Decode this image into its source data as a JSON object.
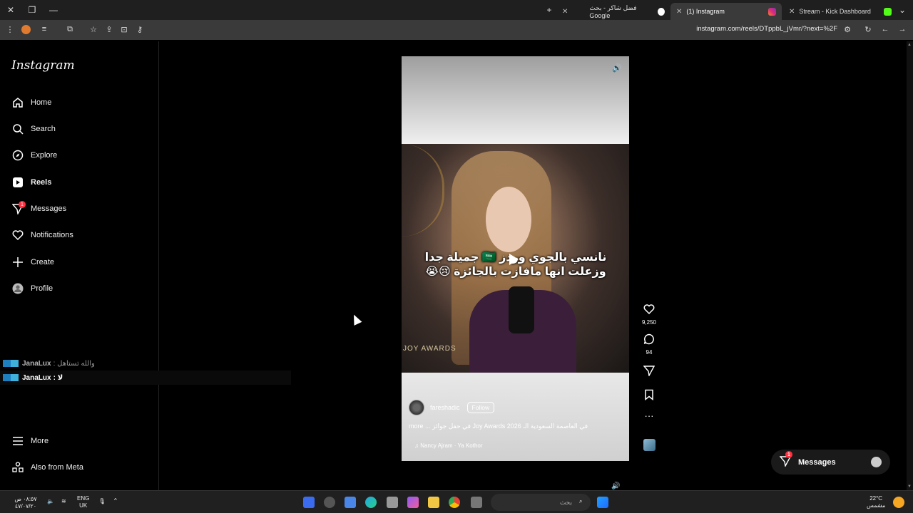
{
  "browser": {
    "tabs": [
      {
        "label": "فضل شاكر - بحث Google",
        "active": false
      },
      {
        "label": "(1) Instagram",
        "active": true
      },
      {
        "label": "Stream - Kick Dashboard",
        "active": false
      }
    ],
    "url": "instagram.com/reels/DTppbL_jVmr/?next=%2F"
  },
  "sidebar": {
    "logo": "Instagram",
    "items": [
      {
        "label": "Home",
        "icon": "home-icon"
      },
      {
        "label": "Search",
        "icon": "search-icon"
      },
      {
        "label": "Explore",
        "icon": "compass-icon"
      },
      {
        "label": "Reels",
        "icon": "reels-icon"
      },
      {
        "label": "Messages",
        "icon": "messages-icon",
        "badge": "1"
      },
      {
        "label": "Notifications",
        "icon": "heart-icon"
      },
      {
        "label": "Create",
        "icon": "plus-icon"
      },
      {
        "label": "Profile",
        "icon": "profile-icon"
      }
    ],
    "more": "More",
    "meta": "Also from Meta"
  },
  "chat": [
    {
      "user": "JanaLux",
      "text": ": والله تستاهل"
    },
    {
      "user": "JanaLux",
      "text": ": لا"
    }
  ],
  "reel": {
    "caption": "نانسي بالجوي وردز 🇸🇦 جميلة جدا وزعلت انها مافازت بالجائزة 😢😭",
    "video_label": "JOY AWARDS",
    "author": "fareshadic",
    "follow": "Follow",
    "description": "more ... في حفل جوائز Joy Awards 2026 في العاصمة السعودية الـ",
    "music": "Nancy Ajram · Ya Kothor",
    "likes": "9,250",
    "comments": "94"
  },
  "messages_button": {
    "label": "Messages",
    "badge": "1"
  },
  "taskbar": {
    "search_placeholder": "بحث",
    "weather_temp": "22°C",
    "weather_desc": "مشمس",
    "lang_top": "ENG",
    "lang_bottom": "UK",
    "time": "٠٨:٥٧ ص",
    "date": "٤٧/٠٧/٢٠"
  }
}
